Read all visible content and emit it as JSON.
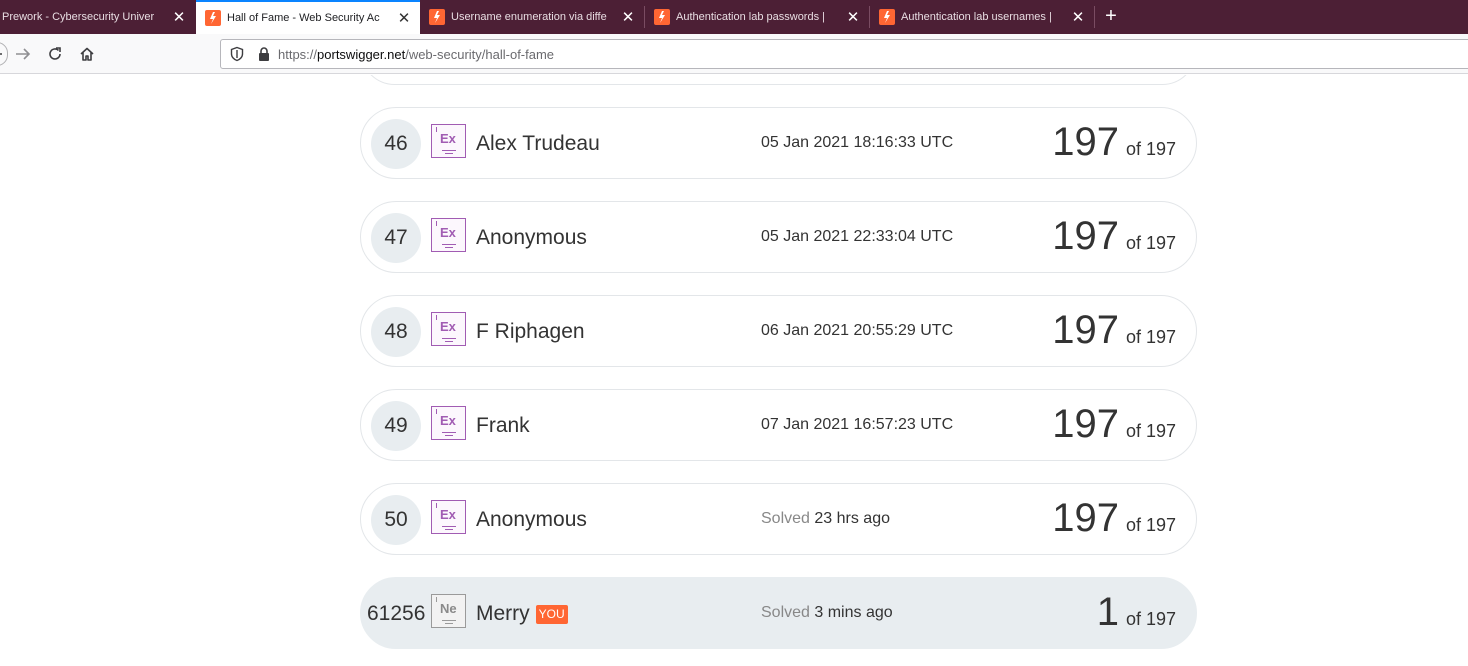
{
  "browser": {
    "tabs": [
      {
        "title": "Prework - Cybersecurity Univer",
        "active": false
      },
      {
        "title": "Hall of Fame - Web Security Ac",
        "active": true
      },
      {
        "title": "Username enumeration via diffe",
        "active": false
      },
      {
        "title": "Authentication lab passwords |",
        "active": false
      },
      {
        "title": "Authentication lab usernames |",
        "active": false
      }
    ],
    "url_prefix": "https://",
    "url_host": "portswigger.net",
    "url_path": "/web-security/hall-of-fame",
    "accent_color": "#0a84ff",
    "tabstrip_color": "#4c1f35"
  },
  "leaderboard": {
    "entries": [
      {
        "rank": "46",
        "badge": "Ex",
        "name": "Alex Trudeau",
        "when_prefix": "",
        "when": "05 Jan 2021 18:16:33 UTC",
        "score": "197",
        "of": "of 197"
      },
      {
        "rank": "47",
        "badge": "Ex",
        "name": "Anonymous",
        "when_prefix": "",
        "when": "05 Jan 2021 22:33:04 UTC",
        "score": "197",
        "of": "of 197"
      },
      {
        "rank": "48",
        "badge": "Ex",
        "name": "F Riphagen",
        "when_prefix": "",
        "when": "06 Jan 2021 20:55:29 UTC",
        "score": "197",
        "of": "of 197"
      },
      {
        "rank": "49",
        "badge": "Ex",
        "name": "Frank",
        "when_prefix": "",
        "when": "07 Jan 2021 16:57:23 UTC",
        "score": "197",
        "of": "of 197"
      },
      {
        "rank": "50",
        "badge": "Ex",
        "name": "Anonymous",
        "when_prefix": "Solved",
        "when": "23 hrs ago",
        "score": "197",
        "of": "of 197"
      }
    ],
    "you": {
      "rank": "61256",
      "badge": "Ne",
      "name": "Merry",
      "you_tag": "YOU",
      "when_prefix": "Solved",
      "when": "3 mins ago",
      "score": "1",
      "of": "of 197"
    },
    "you_tag_color": "#ff6633"
  }
}
